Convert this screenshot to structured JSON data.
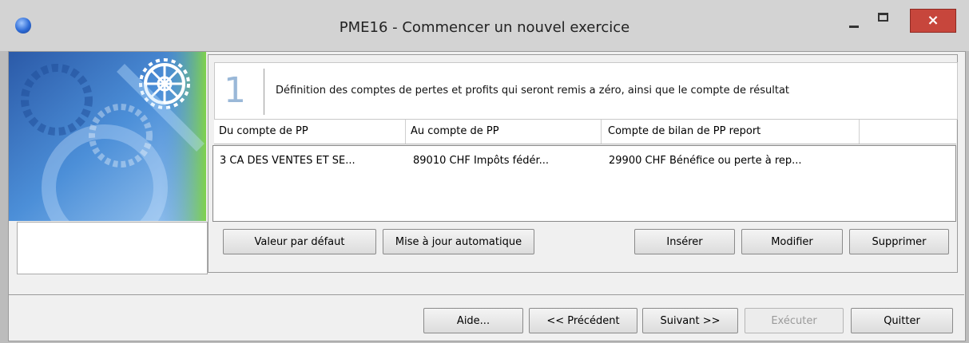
{
  "window": {
    "title": "PME16 - Commencer un nouvel exercice",
    "close_glyph": "×"
  },
  "step": {
    "number": "1",
    "description": "Définition des comptes de pertes et profits qui seront remis a zéro, ainsi que le compte de résultat"
  },
  "grid": {
    "headers": [
      "Du compte de PP",
      "Au compte de PP",
      "Compte de bilan de PP report"
    ],
    "rows": [
      {
        "from": "3    CA DES VENTES ET SE...",
        "to": "89010  CHF  Impôts fédér...",
        "report": "29900  CHF  Bénéfice ou perte à rep..."
      }
    ]
  },
  "panel_buttons": {
    "default": "Valeur par défaut",
    "auto_update": "Mise à jour automatique",
    "insert": "Insérer",
    "modify": "Modifier",
    "delete": "Supprimer"
  },
  "wizard_buttons": {
    "help": "Aide...",
    "previous": "<< Précédent",
    "next": "Suivant  >>",
    "execute": "Exécuter",
    "quit": "Quitter"
  },
  "colors": {
    "close_button": "#c7463c",
    "step_number": "#9ab8d8"
  }
}
